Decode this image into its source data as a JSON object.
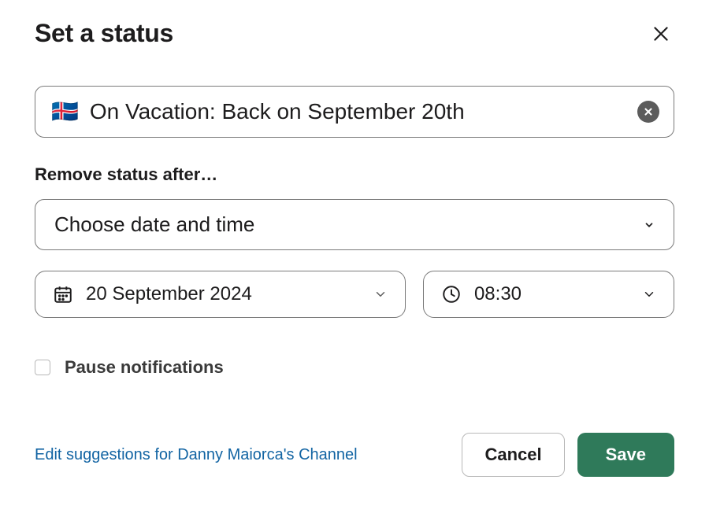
{
  "header": {
    "title": "Set a status"
  },
  "status": {
    "emoji": "🇮🇸",
    "text": "On Vacation: Back on September 20th"
  },
  "remove_after": {
    "label": "Remove status after…",
    "selected_option": "Choose date and time",
    "date": "20 September 2024",
    "time": "08:30"
  },
  "pause_notifications": {
    "label": "Pause notifications",
    "checked": false
  },
  "suggestion_link": "Edit suggestions for Danny Maiorca's Channel",
  "buttons": {
    "cancel": "Cancel",
    "save": "Save"
  }
}
